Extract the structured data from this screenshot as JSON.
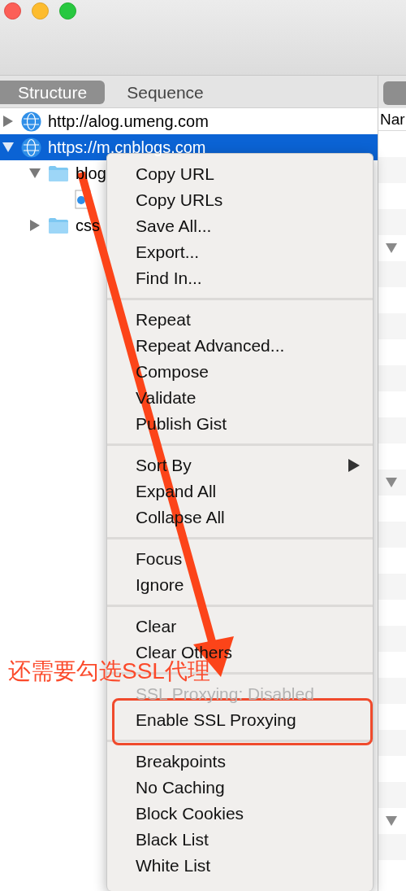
{
  "tabs": [
    {
      "label": "Structure",
      "selected": true
    },
    {
      "label": "Sequence",
      "selected": false
    }
  ],
  "tree": [
    {
      "kind": "host",
      "label": "http://alog.umeng.com",
      "expanded": false,
      "selected": false
    },
    {
      "kind": "host",
      "label": "https://m.cnblogs.com",
      "expanded": true,
      "selected": true,
      "children": [
        {
          "kind": "folder",
          "label": "blog",
          "expanded": true,
          "selected": false,
          "children": [
            {
              "kind": "file",
              "selected": false
            }
          ]
        },
        {
          "kind": "folder",
          "label": "css",
          "expanded": false,
          "selected": false
        }
      ]
    }
  ],
  "detail_panel": {
    "column_header": "Nar"
  },
  "context_menu": {
    "groups": [
      [
        {
          "label": "Copy URL",
          "disabled": false,
          "submenu": false
        },
        {
          "label": "Copy URLs",
          "disabled": false,
          "submenu": false
        },
        {
          "label": "Save All...",
          "disabled": false,
          "submenu": false
        },
        {
          "label": "Export...",
          "disabled": false,
          "submenu": false
        },
        {
          "label": "Find In...",
          "disabled": false,
          "submenu": false
        }
      ],
      [
        {
          "label": "Repeat",
          "disabled": false,
          "submenu": false
        },
        {
          "label": "Repeat Advanced...",
          "disabled": false,
          "submenu": false
        },
        {
          "label": "Compose",
          "disabled": false,
          "submenu": false
        },
        {
          "label": "Validate",
          "disabled": false,
          "submenu": false
        },
        {
          "label": "Publish Gist",
          "disabled": false,
          "submenu": false
        }
      ],
      [
        {
          "label": "Sort By",
          "disabled": false,
          "submenu": true
        },
        {
          "label": "Expand All",
          "disabled": false,
          "submenu": false
        },
        {
          "label": "Collapse All",
          "disabled": false,
          "submenu": false
        }
      ],
      [
        {
          "label": "Focus",
          "disabled": false,
          "submenu": false
        },
        {
          "label": "Ignore",
          "disabled": false,
          "submenu": false
        }
      ],
      [
        {
          "label": "Clear",
          "disabled": false,
          "submenu": false
        },
        {
          "label": "Clear Others",
          "disabled": false,
          "submenu": false
        }
      ],
      [
        {
          "label": "SSL Proxying: Disabled",
          "disabled": true,
          "submenu": false
        },
        {
          "label": "Enable SSL Proxying",
          "disabled": false,
          "submenu": false
        }
      ],
      [
        {
          "label": "Breakpoints",
          "disabled": false,
          "submenu": false
        },
        {
          "label": "No Caching",
          "disabled": false,
          "submenu": false
        },
        {
          "label": "Block Cookies",
          "disabled": false,
          "submenu": false
        },
        {
          "label": "Black List",
          "disabled": false,
          "submenu": false
        },
        {
          "label": "White List",
          "disabled": false,
          "submenu": false
        }
      ]
    ]
  },
  "annotation": {
    "note": "还需要勾选SSL代理"
  }
}
